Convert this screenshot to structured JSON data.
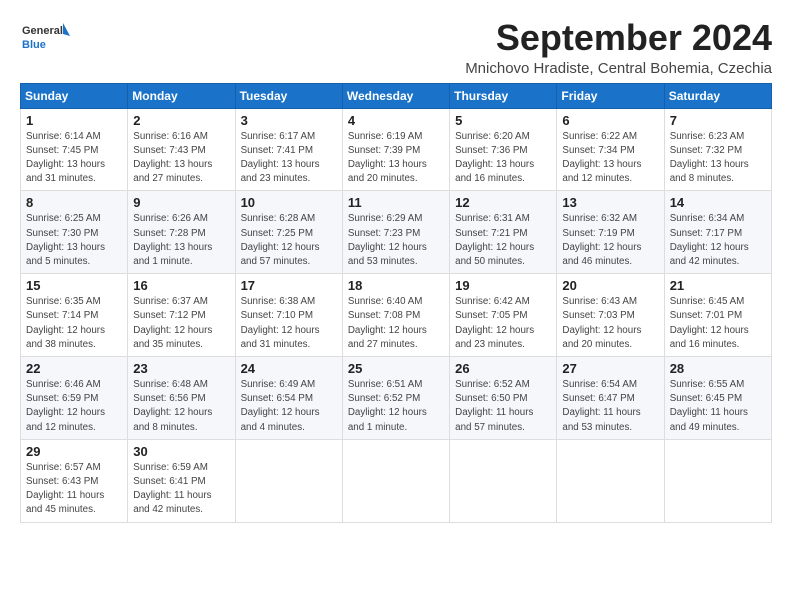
{
  "header": {
    "logo_line1": "General",
    "logo_line2": "Blue",
    "month_title": "September 2024",
    "location": "Mnichovo Hradiste, Central Bohemia, Czechia"
  },
  "days_of_week": [
    "Sunday",
    "Monday",
    "Tuesday",
    "Wednesday",
    "Thursday",
    "Friday",
    "Saturday"
  ],
  "weeks": [
    [
      {
        "day": "1",
        "info": "Sunrise: 6:14 AM\nSunset: 7:45 PM\nDaylight: 13 hours\nand 31 minutes."
      },
      {
        "day": "2",
        "info": "Sunrise: 6:16 AM\nSunset: 7:43 PM\nDaylight: 13 hours\nand 27 minutes."
      },
      {
        "day": "3",
        "info": "Sunrise: 6:17 AM\nSunset: 7:41 PM\nDaylight: 13 hours\nand 23 minutes."
      },
      {
        "day": "4",
        "info": "Sunrise: 6:19 AM\nSunset: 7:39 PM\nDaylight: 13 hours\nand 20 minutes."
      },
      {
        "day": "5",
        "info": "Sunrise: 6:20 AM\nSunset: 7:36 PM\nDaylight: 13 hours\nand 16 minutes."
      },
      {
        "day": "6",
        "info": "Sunrise: 6:22 AM\nSunset: 7:34 PM\nDaylight: 13 hours\nand 12 minutes."
      },
      {
        "day": "7",
        "info": "Sunrise: 6:23 AM\nSunset: 7:32 PM\nDaylight: 13 hours\nand 8 minutes."
      }
    ],
    [
      {
        "day": "8",
        "info": "Sunrise: 6:25 AM\nSunset: 7:30 PM\nDaylight: 13 hours\nand 5 minutes."
      },
      {
        "day": "9",
        "info": "Sunrise: 6:26 AM\nSunset: 7:28 PM\nDaylight: 13 hours\nand 1 minute."
      },
      {
        "day": "10",
        "info": "Sunrise: 6:28 AM\nSunset: 7:25 PM\nDaylight: 12 hours\nand 57 minutes."
      },
      {
        "day": "11",
        "info": "Sunrise: 6:29 AM\nSunset: 7:23 PM\nDaylight: 12 hours\nand 53 minutes."
      },
      {
        "day": "12",
        "info": "Sunrise: 6:31 AM\nSunset: 7:21 PM\nDaylight: 12 hours\nand 50 minutes."
      },
      {
        "day": "13",
        "info": "Sunrise: 6:32 AM\nSunset: 7:19 PM\nDaylight: 12 hours\nand 46 minutes."
      },
      {
        "day": "14",
        "info": "Sunrise: 6:34 AM\nSunset: 7:17 PM\nDaylight: 12 hours\nand 42 minutes."
      }
    ],
    [
      {
        "day": "15",
        "info": "Sunrise: 6:35 AM\nSunset: 7:14 PM\nDaylight: 12 hours\nand 38 minutes."
      },
      {
        "day": "16",
        "info": "Sunrise: 6:37 AM\nSunset: 7:12 PM\nDaylight: 12 hours\nand 35 minutes."
      },
      {
        "day": "17",
        "info": "Sunrise: 6:38 AM\nSunset: 7:10 PM\nDaylight: 12 hours\nand 31 minutes."
      },
      {
        "day": "18",
        "info": "Sunrise: 6:40 AM\nSunset: 7:08 PM\nDaylight: 12 hours\nand 27 minutes."
      },
      {
        "day": "19",
        "info": "Sunrise: 6:42 AM\nSunset: 7:05 PM\nDaylight: 12 hours\nand 23 minutes."
      },
      {
        "day": "20",
        "info": "Sunrise: 6:43 AM\nSunset: 7:03 PM\nDaylight: 12 hours\nand 20 minutes."
      },
      {
        "day": "21",
        "info": "Sunrise: 6:45 AM\nSunset: 7:01 PM\nDaylight: 12 hours\nand 16 minutes."
      }
    ],
    [
      {
        "day": "22",
        "info": "Sunrise: 6:46 AM\nSunset: 6:59 PM\nDaylight: 12 hours\nand 12 minutes."
      },
      {
        "day": "23",
        "info": "Sunrise: 6:48 AM\nSunset: 6:56 PM\nDaylight: 12 hours\nand 8 minutes."
      },
      {
        "day": "24",
        "info": "Sunrise: 6:49 AM\nSunset: 6:54 PM\nDaylight: 12 hours\nand 4 minutes."
      },
      {
        "day": "25",
        "info": "Sunrise: 6:51 AM\nSunset: 6:52 PM\nDaylight: 12 hours\nand 1 minute."
      },
      {
        "day": "26",
        "info": "Sunrise: 6:52 AM\nSunset: 6:50 PM\nDaylight: 11 hours\nand 57 minutes."
      },
      {
        "day": "27",
        "info": "Sunrise: 6:54 AM\nSunset: 6:47 PM\nDaylight: 11 hours\nand 53 minutes."
      },
      {
        "day": "28",
        "info": "Sunrise: 6:55 AM\nSunset: 6:45 PM\nDaylight: 11 hours\nand 49 minutes."
      }
    ],
    [
      {
        "day": "29",
        "info": "Sunrise: 6:57 AM\nSunset: 6:43 PM\nDaylight: 11 hours\nand 45 minutes."
      },
      {
        "day": "30",
        "info": "Sunrise: 6:59 AM\nSunset: 6:41 PM\nDaylight: 11 hours\nand 42 minutes."
      },
      {
        "day": "",
        "info": ""
      },
      {
        "day": "",
        "info": ""
      },
      {
        "day": "",
        "info": ""
      },
      {
        "day": "",
        "info": ""
      },
      {
        "day": "",
        "info": ""
      }
    ]
  ]
}
